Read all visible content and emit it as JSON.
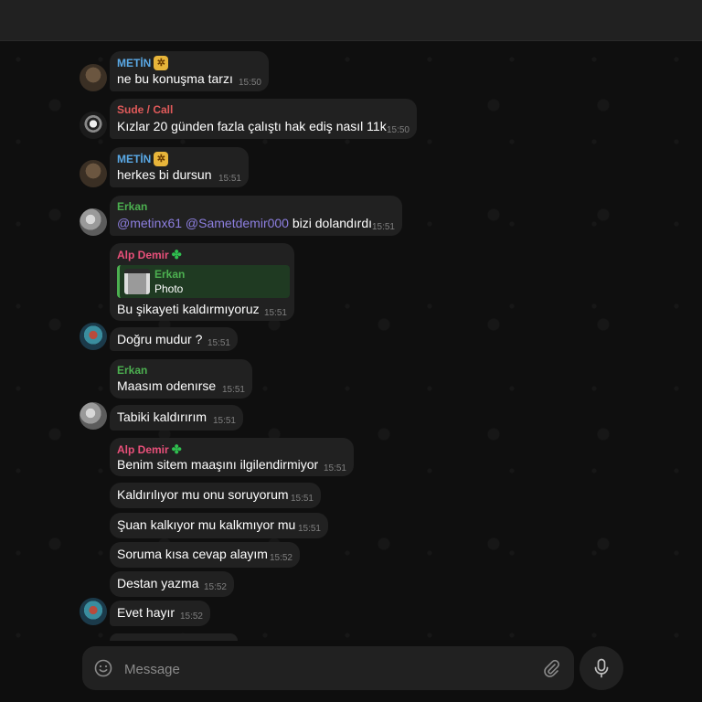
{
  "colors": {
    "metin": "#5aa9e6",
    "sude": "#e05a5a",
    "erkan": "#4cb050",
    "alp": "#e9507a",
    "mention": "#8d7fe0"
  },
  "messages": [
    {
      "sender": "METİN",
      "text": "ne bu konuşma tarzı",
      "time": "15:50"
    },
    {
      "sender": "Sude / Call",
      "text": "Kızlar 20 günden fazla çalıştı hak ediş nasıl 11k",
      "time": "15:50"
    },
    {
      "sender": "METİN",
      "text": "herkes bi dursun",
      "time": "15:51"
    },
    {
      "sender": "Erkan",
      "mention1": "@metinx61",
      "mention2": "@Sametdemir000",
      "text": "bizi dolandırdı",
      "time": "15:51"
    },
    {
      "sender": "Alp Demir",
      "reply_name": "Erkan",
      "reply_text": "Photo",
      "text": "Bu şikayeti kaldırmıyoruz",
      "time": "15:51"
    },
    {
      "text": "Doğru mudur ?",
      "time": "15:51"
    },
    {
      "sender": "Erkan",
      "text": "Maasım odenırse",
      "time": "15:51"
    },
    {
      "text": "Tabiki kaldırırım",
      "time": "15:51"
    },
    {
      "sender": "Alp Demir",
      "text": "Benim sitem maaşını ilgilendirmiyor",
      "time": "15:51"
    },
    {
      "text": "Kaldırılıyor mu onu soruyorum",
      "time": "15:51"
    },
    {
      "text": "Şuan kalkıyor mu kalkmıyor mu",
      "time": "15:51"
    },
    {
      "text": "Soruma kısa cevap alayım",
      "time": "15:52"
    },
    {
      "text": "Destan yazma",
      "time": "15:52"
    },
    {
      "text": "Evet hayır",
      "time": "15:52"
    }
  ],
  "composer": {
    "placeholder": "Message"
  }
}
